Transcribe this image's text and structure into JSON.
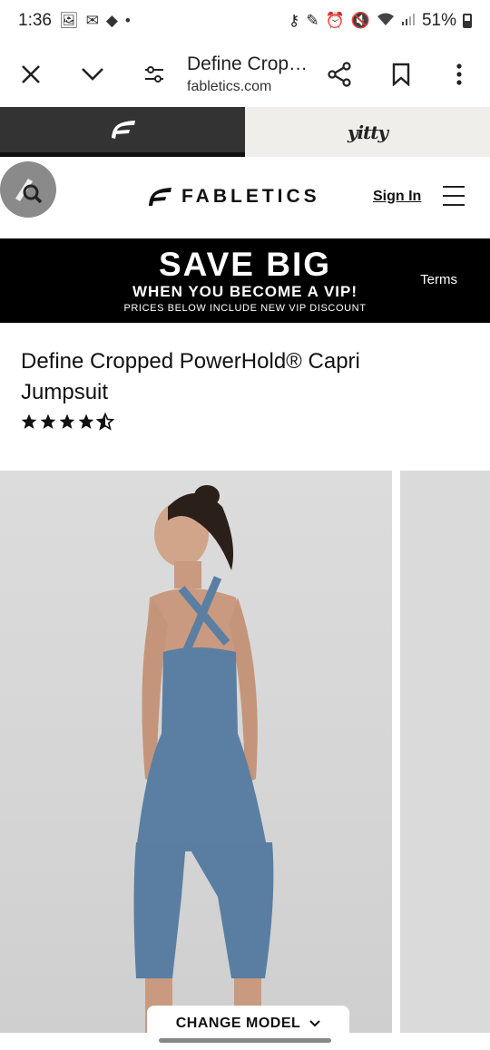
{
  "status_bar": {
    "time": "1:36",
    "battery": "51%",
    "left_icons": [
      "image-icon",
      "gmail-icon",
      "tag-icon",
      "dot-icon"
    ],
    "right_icons": [
      "key-icon",
      "pen-icon",
      "alarm-icon",
      "mute-icon",
      "wifi-icon",
      "signal-icon",
      "battery-icon"
    ]
  },
  "browser": {
    "page_title": "Define Crop…",
    "domain": "fabletics.com"
  },
  "brand_tabs": [
    {
      "label": "Fabletics",
      "active": true
    },
    {
      "label": "yitty",
      "active": false
    }
  ],
  "header": {
    "logo": "FABLETICS",
    "sign_in": "Sign In"
  },
  "promo": {
    "headline": "SAVE BIG",
    "subheadline": "WHEN YOU BECOME A VIP!",
    "fine_print": "PRICES BELOW INCLUDE NEW VIP DISCOUNT",
    "terms": "Terms"
  },
  "product": {
    "title": "Define Cropped PowerHold® Capri Jumpsuit",
    "rating_stars": 4.5
  },
  "gallery": {
    "change_model": "CHANGE MODEL",
    "image_description_icon": "model-photo"
  },
  "colors": {
    "brand_dark": "#333333",
    "promo_bg": "#000000",
    "garment_blue": "#5b7fa3"
  }
}
